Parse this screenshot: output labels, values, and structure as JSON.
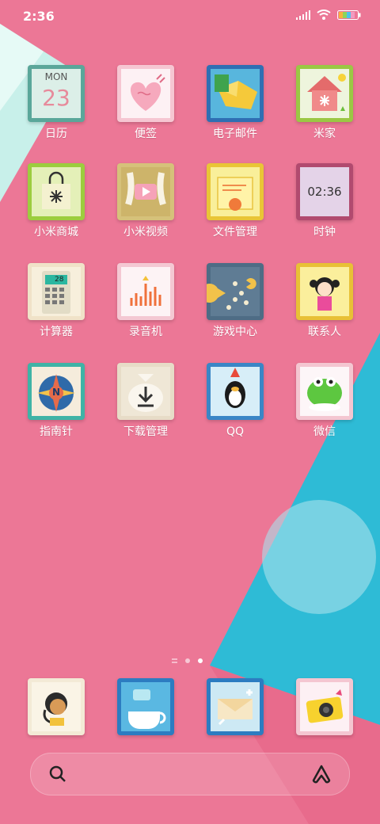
{
  "status_bar": {
    "time": "2:36",
    "icons": [
      "signal-icon",
      "wifi-icon",
      "battery-icon"
    ]
  },
  "apps": [
    {
      "label": "日历",
      "icon": "calendar-icon",
      "icon_month": "MON",
      "icon_day": "23"
    },
    {
      "label": "便签",
      "icon": "notes-icon"
    },
    {
      "label": "电子邮件",
      "icon": "email-icon"
    },
    {
      "label": "米家",
      "icon": "mijia-icon"
    },
    {
      "label": "小米商城",
      "icon": "mi-store-icon"
    },
    {
      "label": "小米视频",
      "icon": "mi-video-icon"
    },
    {
      "label": "文件管理",
      "icon": "file-manager-icon"
    },
    {
      "label": "时钟",
      "icon": "clock-icon",
      "icon_time": "02:36"
    },
    {
      "label": "计算器",
      "icon": "calculator-icon",
      "icon_display": "28"
    },
    {
      "label": "录音机",
      "icon": "recorder-icon"
    },
    {
      "label": "游戏中心",
      "icon": "game-center-icon"
    },
    {
      "label": "联系人",
      "icon": "contacts-icon"
    },
    {
      "label": "指南针",
      "icon": "compass-icon",
      "icon_letter": "N"
    },
    {
      "label": "下载管理",
      "icon": "download-manager-icon"
    },
    {
      "label": "QQ",
      "icon": "qq-icon"
    },
    {
      "label": "微信",
      "icon": "wechat-icon"
    }
  ],
  "page_indicator": {
    "pages": 3,
    "active": 2
  },
  "dock": [
    {
      "icon": "phone-icon"
    },
    {
      "icon": "messages-icon"
    },
    {
      "icon": "browser-icon"
    },
    {
      "icon": "camera-icon"
    }
  ],
  "search_bar": {
    "icons": [
      "search-icon",
      "assistant-icon"
    ]
  },
  "colors": {
    "background": "#ec7796",
    "teal": "#2ebbd6",
    "mint": "#bfeee6"
  }
}
